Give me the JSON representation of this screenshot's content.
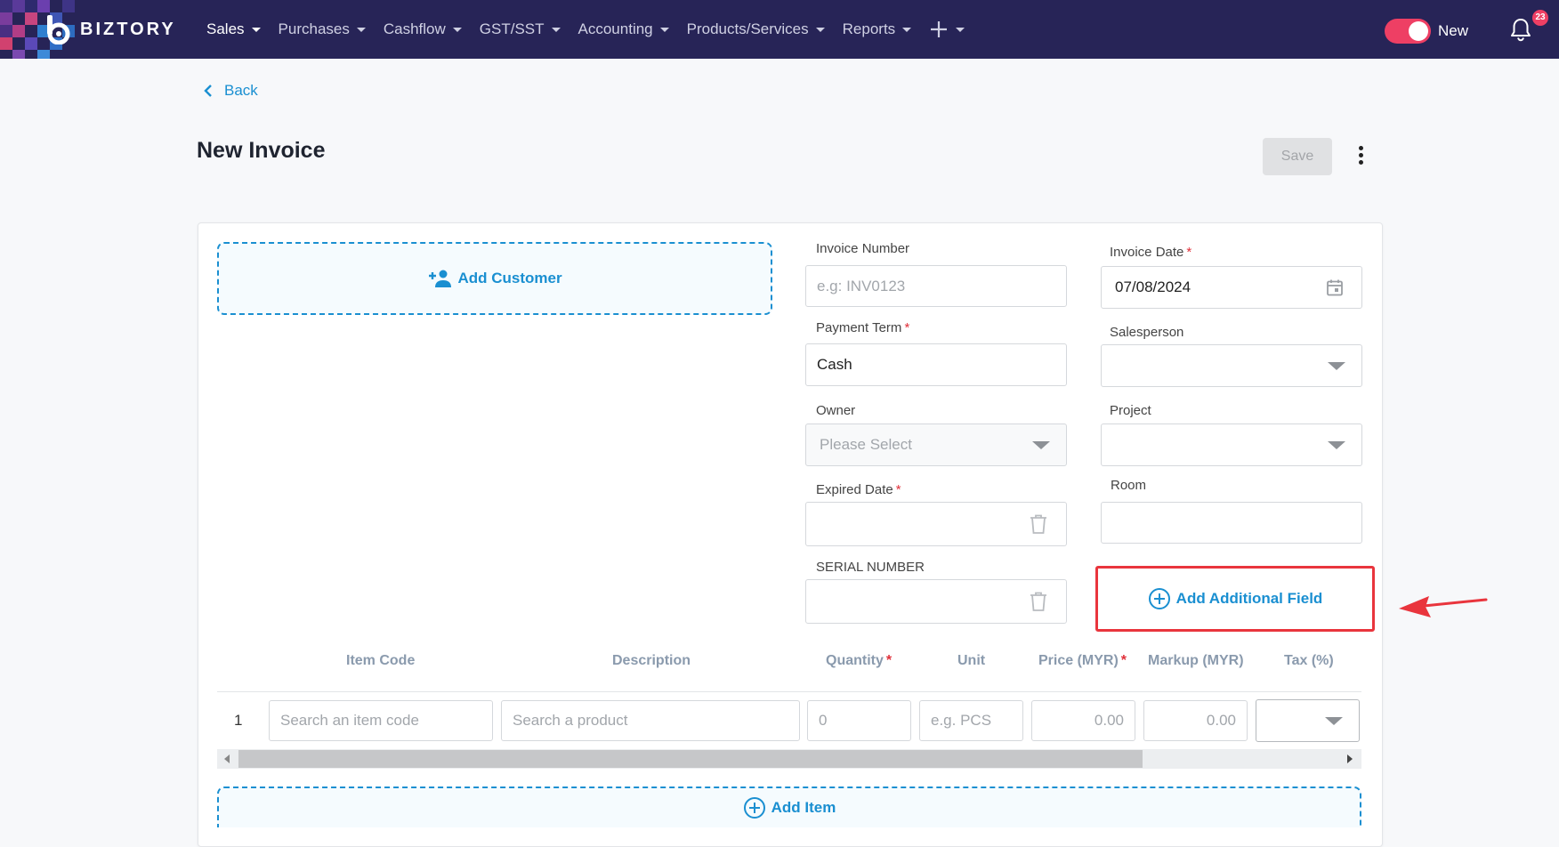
{
  "app": {
    "brand": "BIZTORY"
  },
  "nav": {
    "items": [
      "Sales",
      "Purchases",
      "Cashflow",
      "GST/SST",
      "Accounting",
      "Products/Services",
      "Reports"
    ],
    "toggle_label": "New",
    "notification_count": "23"
  },
  "header": {
    "back_label": "Back",
    "title": "New Invoice",
    "save_label": "Save"
  },
  "customer": {
    "add_label": "Add Customer"
  },
  "form": {
    "invoice_number": {
      "label": "Invoice Number",
      "placeholder": "e.g: INV0123"
    },
    "invoice_date": {
      "label": "Invoice Date",
      "value": "07/08/2024",
      "required": "*"
    },
    "payment_term": {
      "label": "Payment Term",
      "value": "Cash",
      "required": "*"
    },
    "salesperson": {
      "label": "Salesperson"
    },
    "owner": {
      "label": "Owner",
      "placeholder": "Please Select"
    },
    "project": {
      "label": "Project"
    },
    "expired_date": {
      "label": "Expired Date",
      "required": "*"
    },
    "room": {
      "label": "Room"
    },
    "serial_number": {
      "label": "SERIAL NUMBER"
    },
    "add_additional_field": "Add Additional Field"
  },
  "table": {
    "headers": {
      "item_code": "Item Code",
      "description": "Description",
      "quantity": "Quantity",
      "unit": "Unit",
      "price": "Price (MYR)",
      "markup": "Markup (MYR)",
      "tax": "Tax (%)"
    },
    "required_mark": "*",
    "row": {
      "number": "1",
      "item_code_placeholder": "Search an item code",
      "description_placeholder": "Search a product",
      "quantity_placeholder": "0",
      "unit_placeholder": "e.g. PCS",
      "price_placeholder": "0.00",
      "markup_placeholder": "0.00"
    },
    "add_item_label": "Add Item"
  },
  "colors": {
    "nav_bg": "#272457",
    "accent": "#1a8fd1",
    "toggle": "#ee3f64",
    "highlight": "#e9353d"
  }
}
